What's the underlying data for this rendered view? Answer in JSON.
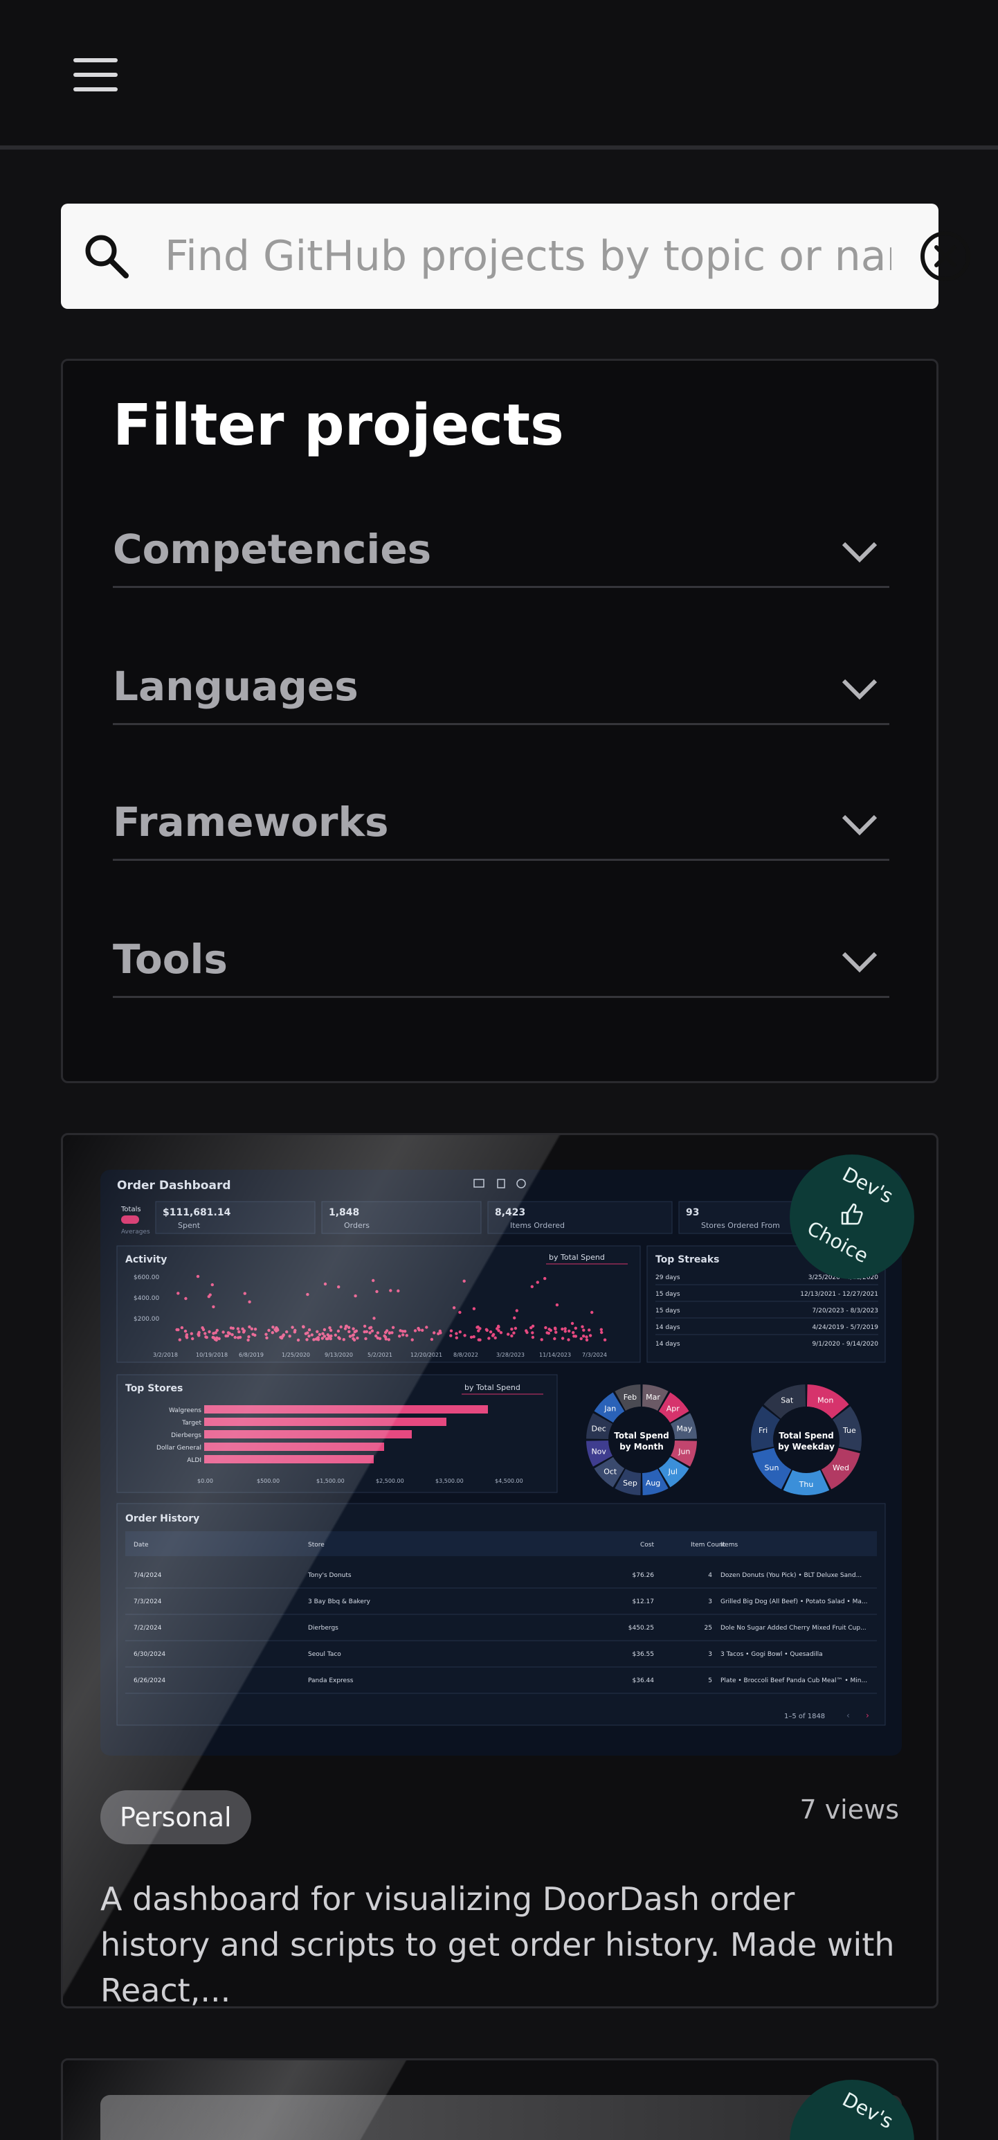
{
  "search": {
    "placeholder": "Find GitHub projects by topic or name"
  },
  "filter": {
    "title": "Filter projects",
    "sections": [
      {
        "label": "Competencies"
      },
      {
        "label": "Languages"
      },
      {
        "label": "Frameworks"
      },
      {
        "label": "Tools"
      }
    ]
  },
  "cards": [
    {
      "badge": {
        "line1": "Dev's",
        "line2": "Choice"
      },
      "tag": "Personal",
      "views": "7 views",
      "description": "A dashboard for visualizing DoorDash order history and scripts to get order history. Made with React,...",
      "dashboard": {
        "title": "Order Dashboard",
        "toggle": {
          "totals": "Totals",
          "averages": "Averages"
        },
        "kpis": [
          {
            "value": "$111,681.14",
            "label": "Spent"
          },
          {
            "value": "1,848",
            "label": "Orders"
          },
          {
            "value": "8,423",
            "label": "Items Ordered"
          },
          {
            "value": "93",
            "label": "Stores Ordered From"
          }
        ],
        "activity": {
          "title": "Activity",
          "sort": "by Total Spend",
          "yticks": [
            "$600.00",
            "$400.00",
            "$200.00"
          ],
          "xticks": [
            "3/2/2018",
            "10/19/2018",
            "6/8/2019",
            "1/25/2020",
            "9/13/2020",
            "5/2/2021",
            "12/20/2021",
            "8/8/2022",
            "3/28/2023",
            "11/14/2023",
            "7/3/2024"
          ]
        },
        "streaks": {
          "title": "Top Streaks",
          "rows": [
            {
              "days": "29 days",
              "range": "3/25/2020 - 4/22/2020"
            },
            {
              "days": "15 days",
              "range": "12/13/2021 - 12/27/2021"
            },
            {
              "days": "15 days",
              "range": "7/20/2023 - 8/3/2023"
            },
            {
              "days": "14 days",
              "range": "4/24/2019 - 5/7/2019"
            },
            {
              "days": "14 days",
              "range": "9/1/2020 - 9/14/2020"
            }
          ]
        },
        "stores": {
          "title": "Top Stores",
          "sort": "by Total Spend",
          "names": [
            "Walgreens",
            "Target",
            "Dierbergs",
            "Dollar General",
            "ALDI"
          ],
          "values": [
            4100,
            3500,
            3000,
            2600,
            2450
          ],
          "xticks": [
            "$0.00",
            "$500.00",
            "$1,500.00",
            "$2,500.00",
            "$3,500.00",
            "$4,500.00"
          ]
        },
        "month_donut": {
          "title1": "Total Spend",
          "title2": "by Month",
          "labels": [
            "Mar",
            "Apr",
            "May",
            "Jun",
            "Jul",
            "Aug",
            "Sep",
            "Oct",
            "Nov",
            "Dec",
            "Jan",
            "Feb"
          ]
        },
        "weekday_donut": {
          "title1": "Total Spend",
          "title2": "by Weekday",
          "labels": [
            "Mon",
            "Tue",
            "Wed",
            "Thu",
            "Sun",
            "Fri",
            "Sat"
          ]
        },
        "history": {
          "title": "Order History",
          "columns": [
            "Date",
            "Store",
            "Cost",
            "Item Count",
            "Items"
          ],
          "rows": [
            [
              "7/4/2024",
              "Tony's Donuts",
              "$76.26",
              "4",
              "Dozen Donuts (You Pick) • BLT Deluxe Sand..."
            ],
            [
              "7/3/2024",
              "3 Bay Bbq & Bakery",
              "$12.17",
              "3",
              "Grilled Big Dog (All Beef) • Potato Salad • Ma..."
            ],
            [
              "7/2/2024",
              "Dierbergs",
              "$450.25",
              "25",
              "Dole No Sugar Added Cherry Mixed Fruit Cup..."
            ],
            [
              "6/30/2024",
              "Seoul Taco",
              "$36.55",
              "3",
              "3 Tacos • Gogi Bowl • Quesadilla"
            ],
            [
              "6/26/2024",
              "Panda Express",
              "$36.44",
              "5",
              "Plate • Broccoli Beef Panda Cub Meal™ • Min..."
            ]
          ],
          "pagination": "1–5 of 1848"
        }
      }
    },
    {
      "badge": {
        "line1": "Dev's",
        "line2": ""
      }
    }
  ]
}
